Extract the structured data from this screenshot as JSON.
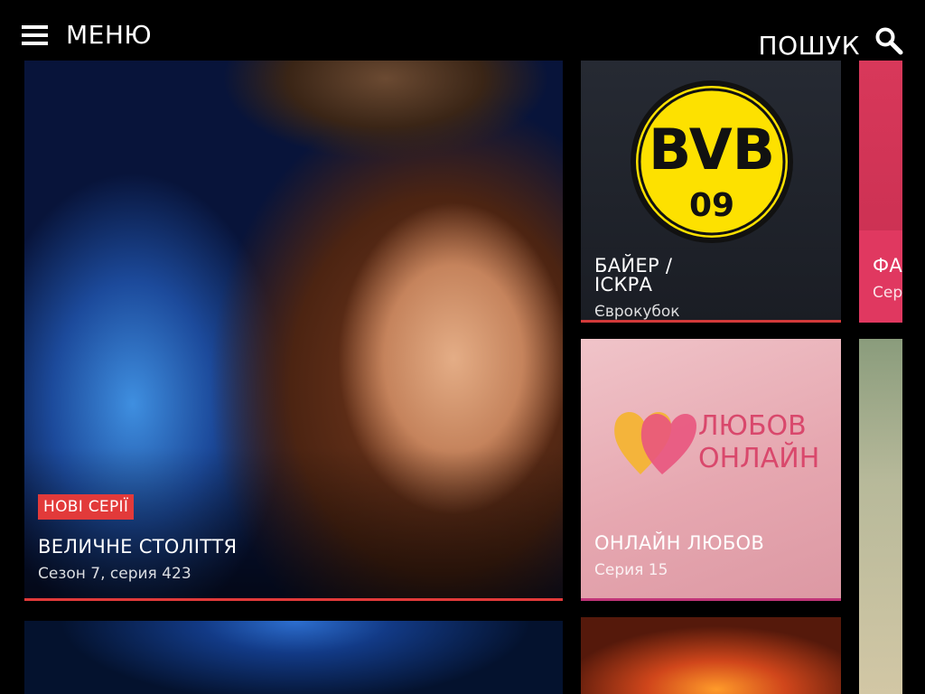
{
  "header": {
    "menu_label": "МЕНЮ",
    "search_label": "ПОШУК",
    "menu_icon": "hamburger-icon",
    "search_icon": "search-icon"
  },
  "tiles": {
    "hero": {
      "badge": "НОВІ СЕРІЇ",
      "title": "ВЕЛИЧНЕ СТОЛІТТЯ",
      "subtitle": "Сезон 7, серия 423",
      "bar_color": "#e23a3a"
    },
    "bvb": {
      "logo_text_top": "BVB",
      "logo_text_bottom": "09",
      "title_line1": "БАЙЕР /",
      "title_line2": "ІСКРА",
      "subtitle": "Єврокубок",
      "bar_color": "#d23a3a"
    },
    "love": {
      "logo_line1": "ЛЮБОВ",
      "logo_line2": "ОНЛАЙН",
      "title": "ОНЛАЙН ЛЮБОВ",
      "subtitle": "Серия 15",
      "bar_color": "#c03478"
    },
    "right1": {
      "title": "ФА",
      "subtitle": "Сер"
    }
  },
  "colors": {
    "background": "#000000",
    "accent_red": "#e23a3a",
    "bvb_yellow": "#fde100"
  }
}
